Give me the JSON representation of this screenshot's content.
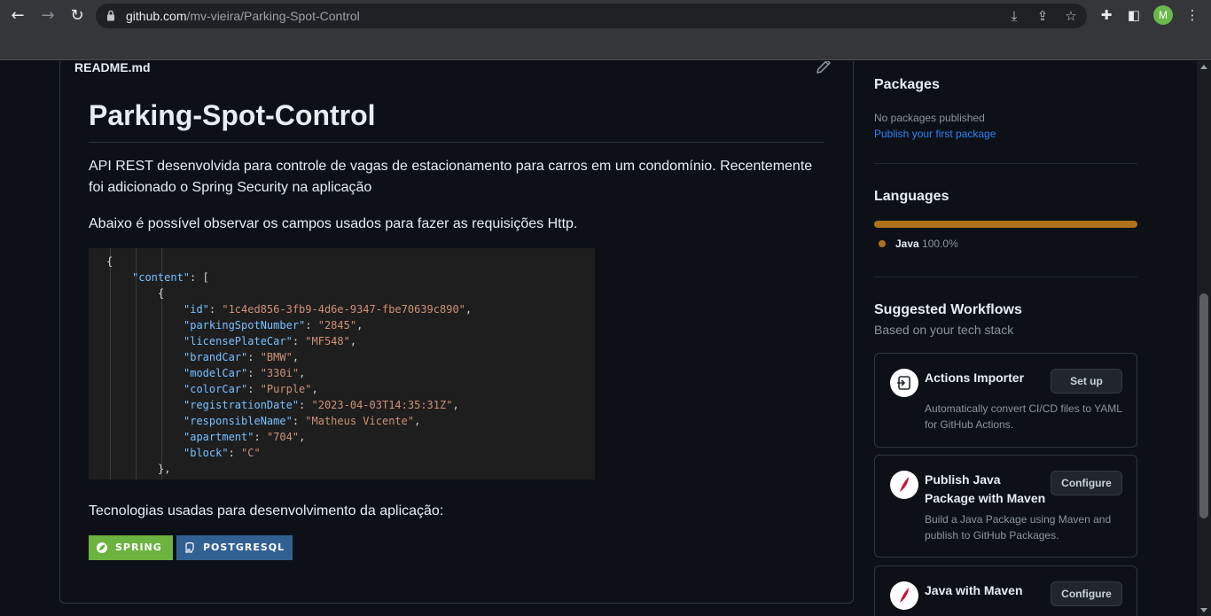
{
  "browser": {
    "url_host": "github.com",
    "url_path": "/mv-vieira/Parking-Spot-Control",
    "avatar_letter": "M"
  },
  "readme": {
    "filename": "README.md",
    "title": "Parking-Spot-Control",
    "paragraph1": "API REST desenvolvida para controle de vagas de estacionamento para carros em um condomínio. Recentemente foi adicionado o Spring Security na aplicação",
    "paragraph2": "Abaixo é possível observar os campos usados para fazer as requisições Http.",
    "code_lines": [
      "{",
      "\"content\": [",
      "{",
      "\"id\": \"1c4ed856-3fb9-4d6e-9347-fbe70639c890\",",
      "\"parkingSpotNumber\": \"2845\",",
      "\"licensePlateCar\": \"MF548\",",
      "\"brandCar\": \"BMW\",",
      "\"modelCar\": \"330i\",",
      "\"colorCar\": \"Purple\",",
      "\"registrationDate\": \"2023-04-03T14:35:31Z\",",
      "\"responsibleName\": \"Matheus Vicente\",",
      "\"apartment\": \"704\",",
      "\"block\": \"C\"",
      "},"
    ],
    "code_fields": [
      {
        "key": "\"id\"",
        "value": "\"1c4ed856-3fb9-4d6e-9347-fbe70639c890\"",
        "comma": ","
      },
      {
        "key": "\"parkingSpotNumber\"",
        "value": "\"2845\"",
        "comma": ","
      },
      {
        "key": "\"licensePlateCar\"",
        "value": "\"MF548\"",
        "comma": ","
      },
      {
        "key": "\"brandCar\"",
        "value": "\"BMW\"",
        "comma": ","
      },
      {
        "key": "\"modelCar\"",
        "value": "\"330i\"",
        "comma": ","
      },
      {
        "key": "\"colorCar\"",
        "value": "\"Purple\"",
        "comma": ","
      },
      {
        "key": "\"registrationDate\"",
        "value": "\"2023-04-03T14:35:31Z\"",
        "comma": ","
      },
      {
        "key": "\"responsibleName\"",
        "value": "\"Matheus Vicente\"",
        "comma": ","
      },
      {
        "key": "\"apartment\"",
        "value": "\"704\"",
        "comma": ","
      },
      {
        "key": "\"block\"",
        "value": "\"C\"",
        "comma": ""
      }
    ],
    "paragraph3": "Tecnologias usadas para desenvolvimento da aplicação:",
    "badges": [
      {
        "label": "SPRING",
        "color": "#6db33f"
      },
      {
        "label": "POSTGRESQL",
        "color": "#316192"
      }
    ]
  },
  "sidebar": {
    "packages": {
      "heading": "Packages",
      "empty_text": "No packages published",
      "link": "Publish your first package"
    },
    "languages": {
      "heading": "Languages",
      "items": [
        {
          "name": "Java",
          "percent": "100.0%",
          "color": "#b07219",
          "share": 1.0
        }
      ]
    },
    "workflows": {
      "heading": "Suggested Workflows",
      "subheading": "Based on your tech stack",
      "cards": [
        {
          "title": "Actions Importer",
          "description": "Automatically convert CI/CD files to YAML for GitHub Actions.",
          "button": "Set up",
          "icon": "actions-importer-icon"
        },
        {
          "title": "Publish Java Package with Maven",
          "description": "Build a Java Package using Maven and publish to GitHub Packages.",
          "button": "Configure",
          "icon": "maven-feather-icon"
        },
        {
          "title": "Java with Maven",
          "description": "",
          "button": "Configure",
          "icon": "maven-feather-icon"
        }
      ]
    }
  },
  "colors": {
    "page_bg": "#0d1117",
    "border": "#30363d",
    "link": "#2f81f7",
    "java": "#b07219"
  }
}
